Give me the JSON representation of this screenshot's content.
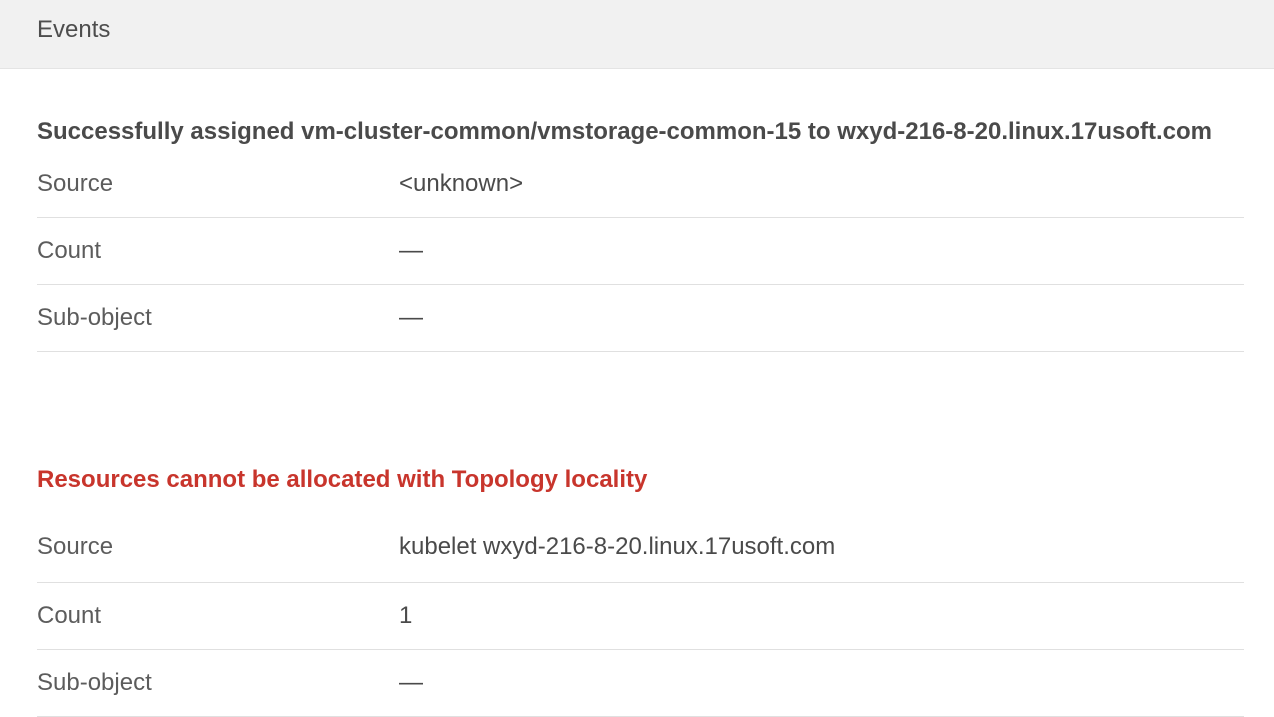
{
  "header": {
    "title": "Events"
  },
  "events": [
    {
      "title": "Successfully assigned vm-cluster-common/vmstorage-common-15 to wxyd-216-8-20.linux.17usoft.com",
      "type": "normal",
      "rows": [
        {
          "label": "Source",
          "value": "<unknown>"
        },
        {
          "label": "Count",
          "value": "—"
        },
        {
          "label": "Sub-object",
          "value": "—"
        }
      ]
    },
    {
      "title": "Resources cannot be allocated with Topology locality",
      "type": "warning",
      "rows": [
        {
          "label": "Source",
          "value": "kubelet wxyd-216-8-20.linux.17usoft.com"
        },
        {
          "label": "Count",
          "value": "1"
        },
        {
          "label": "Sub-object",
          "value": "—"
        }
      ]
    }
  ],
  "colors": {
    "warning": "#c8352c",
    "header_bg": "#f1f1f1",
    "text": "#4a4a4a"
  }
}
